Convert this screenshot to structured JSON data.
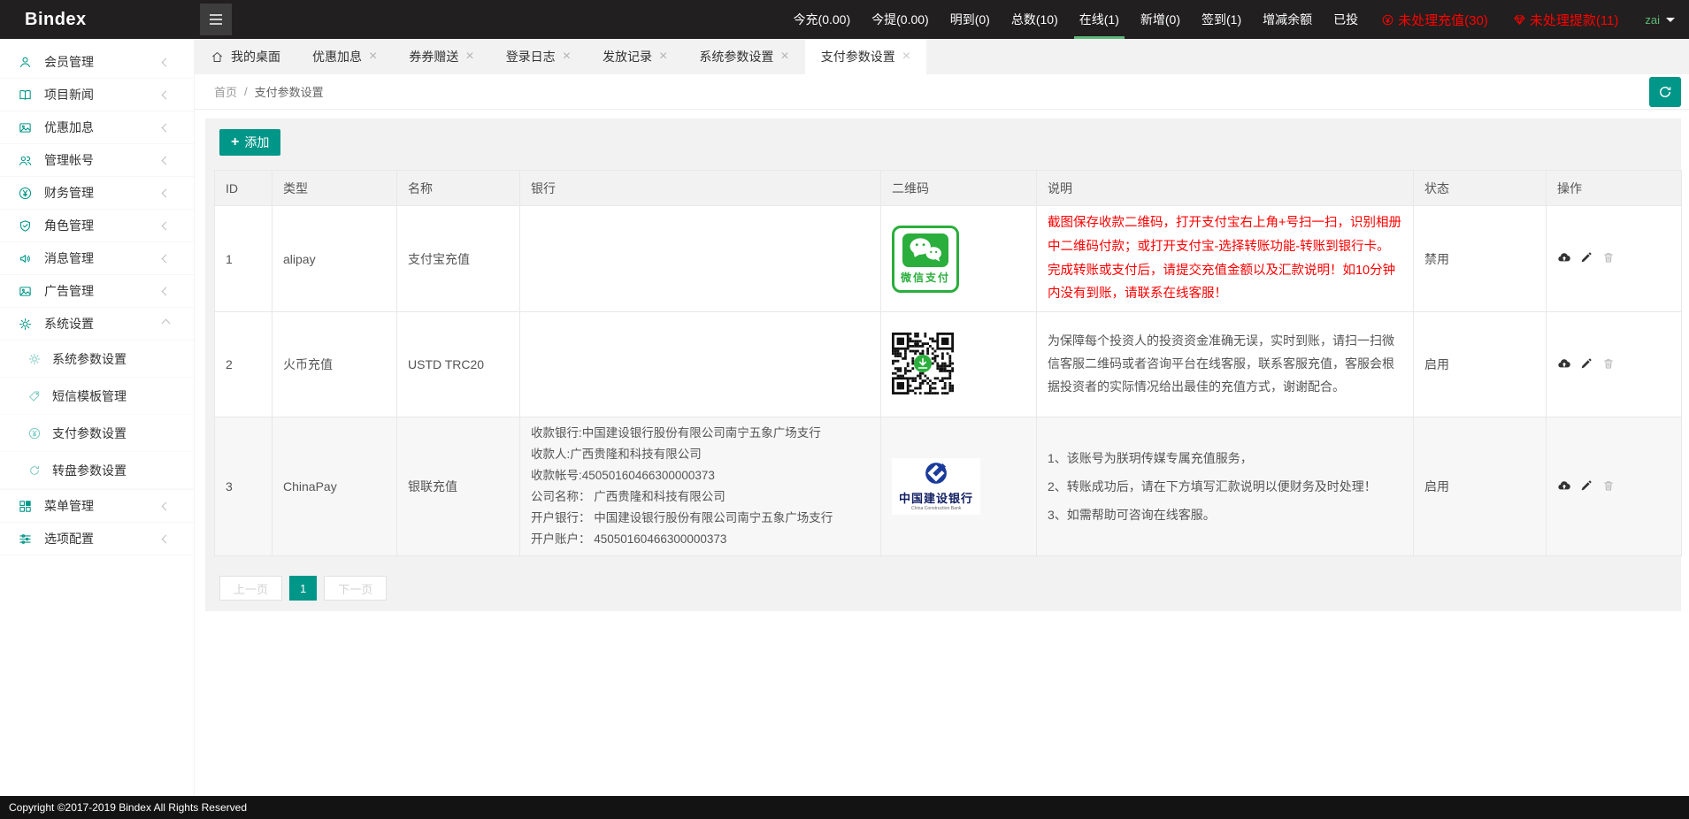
{
  "navbar": {
    "brand": "Bindex",
    "stats": [
      {
        "label": "今充(0.00)",
        "active": false
      },
      {
        "label": "今提(0.00)",
        "active": false
      },
      {
        "label": "明到(0)",
        "active": false
      },
      {
        "label": "总数(10)",
        "active": false
      },
      {
        "label": "在线(1)",
        "active": true
      },
      {
        "label": "新增(0)",
        "active": false
      },
      {
        "label": "签到(1)",
        "active": false
      },
      {
        "label": "增减余额",
        "active": false
      },
      {
        "label": "已投",
        "active": false
      }
    ],
    "alerts": [
      {
        "icon": "coin-yen-icon",
        "label": "未处理充值(30)"
      },
      {
        "icon": "gem-icon",
        "label": "未处理提款(11)"
      }
    ],
    "username": "zai"
  },
  "sidebar": {
    "items": [
      {
        "icon": "user-icon",
        "label": "会员管理",
        "chevron": "left"
      },
      {
        "icon": "book-icon",
        "label": "项目新闻",
        "chevron": "left"
      },
      {
        "icon": "image-icon",
        "label": "优惠加息",
        "chevron": "left"
      },
      {
        "icon": "users-icon",
        "label": "管理帐号",
        "chevron": "left"
      },
      {
        "icon": "yen-circle-icon",
        "label": "财务管理",
        "chevron": "left"
      },
      {
        "icon": "shield-check-icon",
        "label": "角色管理",
        "chevron": "left"
      },
      {
        "icon": "speaker-icon",
        "label": "消息管理",
        "chevron": "left"
      },
      {
        "icon": "image-icon",
        "label": "广告管理",
        "chevron": "left"
      },
      {
        "icon": "gear-icon",
        "label": "系统设置",
        "chevron": "down",
        "expanded": true,
        "children": [
          {
            "icon": "gear-icon",
            "label": "系统参数设置"
          },
          {
            "icon": "tag-icon",
            "label": "短信模板管理"
          },
          {
            "icon": "yen-circle-icon",
            "label": "支付参数设置"
          },
          {
            "icon": "refresh-icon",
            "label": "转盘参数设置"
          }
        ]
      },
      {
        "icon": "grid-icon",
        "label": "菜单管理",
        "chevron": "left"
      },
      {
        "icon": "sliders-icon",
        "label": "选项配置",
        "chevron": "left"
      }
    ]
  },
  "tabs": [
    {
      "label": "我的桌面",
      "icon": "home-icon",
      "closable": false,
      "active": false
    },
    {
      "label": "优惠加息",
      "closable": true,
      "active": false
    },
    {
      "label": "券券赠送",
      "closable": true,
      "active": false
    },
    {
      "label": "登录日志",
      "closable": true,
      "active": false
    },
    {
      "label": "发放记录",
      "closable": true,
      "active": false
    },
    {
      "label": "系统参数设置",
      "closable": true,
      "active": false
    },
    {
      "label": "支付参数设置",
      "closable": true,
      "active": true
    }
  ],
  "breadcrumb": {
    "items": [
      "首页",
      "支付参数设置"
    ],
    "separator": "/"
  },
  "toolbar": {
    "add_label": "添加"
  },
  "table": {
    "columns": [
      "ID",
      "类型",
      "名称",
      "银行",
      "二维码",
      "说明",
      "状态",
      "操作"
    ],
    "rows": [
      {
        "id": "1",
        "type": "alipay",
        "name": "支付宝充值",
        "bank_lines": [],
        "qr": "wechat-pay",
        "desc_lines": [
          "截图保存收款二维码，打开支付宝右上角+号扫一扫，识别相册中二维码付款；或打开支付宝-选择转账功能-转账到银行卡。",
          "完成转账或支付后，请提交充值金额以及汇款说明！如10分钟内没有到账，请联系在线客服！"
        ],
        "desc_style": "alert",
        "status": "禁用"
      },
      {
        "id": "2",
        "type": "火币充值",
        "name": "USTD TRC20",
        "bank_lines": [],
        "qr": "qrcode",
        "desc_lines": [
          "为保障每个投资人的投资资金准确无误，实时到账，请扫一扫微信客服二维码或者咨询平台在线客服，联系客服充值，客服会根据投资者的实际情况给出最佳的充值方式，谢谢配合。"
        ],
        "desc_style": "normal",
        "status": "启用"
      },
      {
        "id": "3",
        "type": "ChinaPay",
        "name": "银联充值",
        "bank_lines": [
          "收款银行:中国建设银行股份有限公司南宁五象广场支行",
          "收款人:广西贵隆和科技有限公司",
          "收款帐号:45050160466300000373",
          "公司名称： 广西贵隆和科技有限公司",
          "开户银行： 中国建设银行股份有限公司南宁五象广场支行",
          "开户账户： 45050160466300000373"
        ],
        "qr": "ccb",
        "desc_lines": [
          "1、该账号为朕玥传媒专属充值服务，",
          "2、转账成功后，请在下方填写汇款说明以便财务及时处理！",
          "3、如需帮助可咨询在线客服。"
        ],
        "desc_style": "list",
        "status": "启用"
      }
    ],
    "row_actions": [
      {
        "icon": "cloud-upload-icon",
        "name": "upload-action-button"
      },
      {
        "icon": "edit-icon",
        "name": "edit-action-button"
      },
      {
        "icon": "trash-icon",
        "name": "delete-action-button"
      }
    ]
  },
  "qr_labels": {
    "wechat": "微信支付",
    "ccb_cn": "中国建设银行",
    "ccb_en": "China Construction Bank"
  },
  "pagination": {
    "prev_label": "上一页",
    "current_page": "1",
    "next_label": "下一页"
  },
  "footer": {
    "copyright": "Copyright ©2017-2019 Bindex All Rights Reserved"
  },
  "colors": {
    "accent": "#009688",
    "alert_red": "#ff0000",
    "username_green": "#5fb878",
    "wechat_green": "#2aae3c",
    "ccb_blue": "#1b3b9b",
    "navbar_bg": "#211f1f"
  }
}
